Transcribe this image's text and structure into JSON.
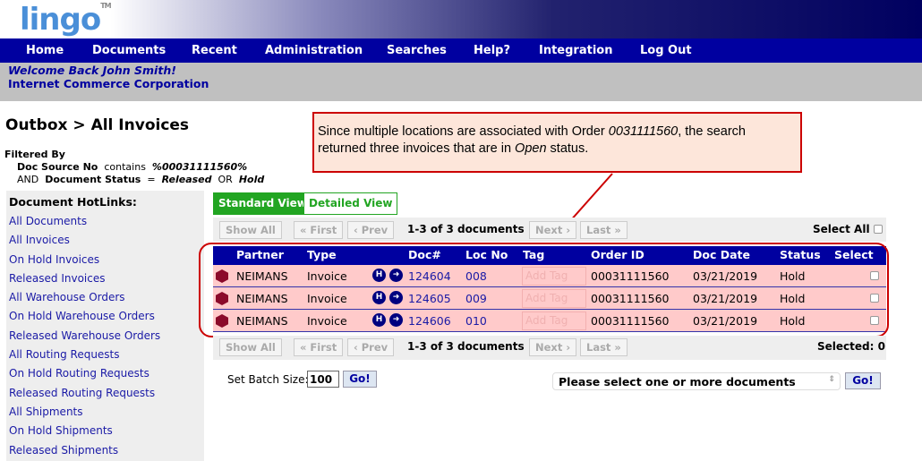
{
  "logo": {
    "text": "lingo",
    "tm": "TM"
  },
  "nav": [
    "Home",
    "Documents",
    "Recent",
    "Administration",
    "Searches",
    "Help?",
    "Integration",
    "Log Out"
  ],
  "welcome": {
    "greeting": "Welcome Back John Smith!",
    "company": "Internet Commerce Corporation"
  },
  "page_title": "Outbox > All Invoices",
  "filter": {
    "label": "Filtered By",
    "field1": "Doc Source No",
    "op1": "contains",
    "val1": "%00031111560%",
    "join": "AND",
    "field2": "Document Status",
    "op2": "=",
    "val2a": "Released",
    "or": "OR",
    "val2b": "Hold"
  },
  "callout": {
    "t1": "Since multiple locations are associated with Order ",
    "order": "0031111560",
    "t2": ", the search returned three invoices that are in ",
    "status": "Open",
    "t3": " status."
  },
  "sidebar": {
    "title": "Document HotLinks:",
    "items": [
      "All Documents",
      "All Invoices",
      "On Hold Invoices",
      "Released Invoices",
      "All Warehouse Orders",
      "On Hold Warehouse Orders",
      "Released Warehouse Orders",
      "All Routing Requests",
      "On Hold Routing Requests",
      "Released Routing Requests",
      "All Shipments",
      "On Hold Shipments",
      "Released Shipments"
    ]
  },
  "tabs": [
    "Standard View",
    "Detailed View"
  ],
  "pager": {
    "show_all": "Show All",
    "first": "« First",
    "prev": "‹ Prev",
    "count": "1-3 of 3 documents",
    "next": "Next ›",
    "last": "Last »",
    "select_all": "Select All",
    "selected": "Selected: 0"
  },
  "table": {
    "headers": [
      "Partner",
      "Type",
      "Doc#",
      "Loc No",
      "Tag",
      "Order ID",
      "Doc Date",
      "Status",
      "Select"
    ],
    "rows": [
      {
        "partner": "NEIMANS",
        "type": "Invoice",
        "doc": "124604",
        "loc": "008",
        "tag": "Add Tag",
        "order": "00031111560",
        "date": "03/21/2019",
        "status": "Hold"
      },
      {
        "partner": "NEIMANS",
        "type": "Invoice",
        "doc": "124605",
        "loc": "009",
        "tag": "Add Tag",
        "order": "00031111560",
        "date": "03/21/2019",
        "status": "Hold"
      },
      {
        "partner": "NEIMANS",
        "type": "Invoice",
        "doc": "124606",
        "loc": "010",
        "tag": "Add Tag",
        "order": "00031111560",
        "date": "03/21/2019",
        "status": "Hold"
      }
    ],
    "hold_icon": "H",
    "arrow_icon": "➜"
  },
  "batch": {
    "label": "Set Batch Size:",
    "value": "100",
    "go": "Go!"
  },
  "action": {
    "placeholder": "Please select one or more documents",
    "go": "Go!"
  },
  "colors": {
    "nav": "#0000a0",
    "accent_green": "#22a522",
    "row_bg": "#ffcaca",
    "annotation": "#cc0000"
  }
}
